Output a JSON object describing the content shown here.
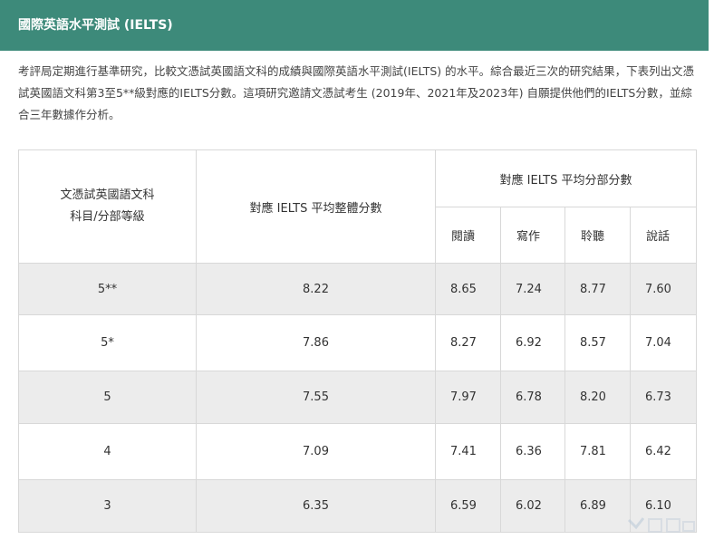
{
  "header": {
    "title": "國際英語水平測試 (IELTS)"
  },
  "intro": {
    "text": "考評局定期進行基準研究，比較文憑試英國語文科的成績與國際英語水平測試(IELTS) 的水平。綜合最近三次的研究結果，下表列出文憑試英國語文科第3至5**級對應的IELTS分數。這項研究邀請文憑試考生 (2019年、2021年及2023年) 自願提供他們的IELTS分數，並綜合三年數據作分析。"
  },
  "table": {
    "col_subject": "文憑試英國語文科\n科目/分部等級",
    "col_overall": "對應 IELTS 平均整體分數",
    "col_group": "對應 IELTS 平均分部分數",
    "sub_headers": [
      "閱讀",
      "寫作",
      "聆聽",
      "說話"
    ],
    "rows": [
      {
        "level": "5**",
        "overall": "8.22",
        "reading": "8.65",
        "writing": "7.24",
        "listening": "8.77",
        "speaking": "7.60"
      },
      {
        "level": "5*",
        "overall": "7.86",
        "reading": "8.27",
        "writing": "6.92",
        "listening": "8.57",
        "speaking": "7.04"
      },
      {
        "level": "5",
        "overall": "7.55",
        "reading": "7.97",
        "writing": "6.78",
        "listening": "8.20",
        "speaking": "6.73"
      },
      {
        "level": "4",
        "overall": "7.09",
        "reading": "7.41",
        "writing": "6.36",
        "listening": "7.81",
        "speaking": "6.42"
      },
      {
        "level": "3",
        "overall": "6.35",
        "reading": "6.59",
        "writing": "6.02",
        "listening": "6.89",
        "speaking": "6.10"
      }
    ]
  },
  "colors": {
    "header_bg": "#3d8a7a",
    "row_shade": "#ececec",
    "border": "#d8d8d8"
  }
}
